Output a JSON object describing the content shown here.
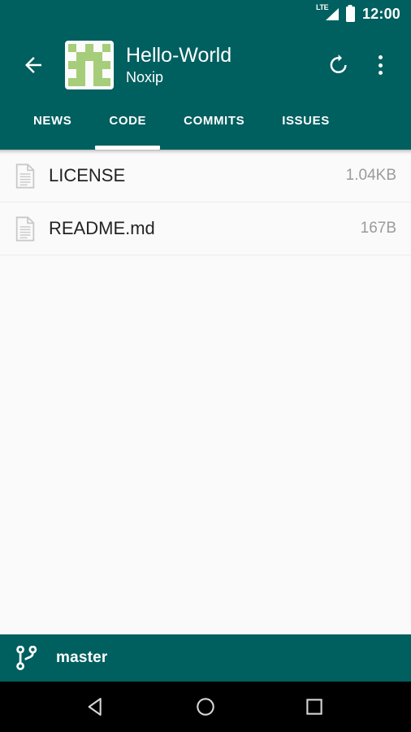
{
  "status_bar": {
    "network_label": "LTE",
    "signal_icon": "signal-bars-icon",
    "battery_icon": "battery-full-icon",
    "clock": "12:00"
  },
  "app_bar": {
    "back_icon": "back-arrow-icon",
    "avatar_icon": "repository-identicon-avatar",
    "avatar_color": "#a6cd79",
    "avatar_bg": "#fbfbfb",
    "title": "Hello-World",
    "subtitle": "Noxip",
    "refresh_icon": "refresh-icon",
    "overflow_icon": "overflow-menu-icon"
  },
  "tabs": {
    "accent_color": "#ffffff",
    "bar_color": "#005f5f",
    "items": [
      {
        "label": "NEWS",
        "active": false
      },
      {
        "label": "CODE",
        "active": true
      },
      {
        "label": "COMMITS",
        "active": false
      },
      {
        "label": "ISSUES",
        "active": false
      }
    ]
  },
  "file_list": {
    "icon": "file-document-icon",
    "rows": [
      {
        "name": "LICENSE",
        "size": "1.04KB"
      },
      {
        "name": "README.md",
        "size": "167B"
      }
    ]
  },
  "branch_bar": {
    "icon": "git-branch-icon",
    "name": "master"
  },
  "nav_bar": {
    "back_icon": "nav-back-triangle-icon",
    "home_icon": "nav-home-circle-icon",
    "recents_icon": "nav-recents-square-icon"
  },
  "avatar_grid": [
    [
      1,
      0,
      1,
      0,
      1
    ],
    [
      0,
      1,
      1,
      1,
      0
    ],
    [
      1,
      1,
      0,
      1,
      1
    ],
    [
      0,
      1,
      0,
      1,
      0
    ],
    [
      1,
      1,
      0,
      1,
      1
    ]
  ]
}
